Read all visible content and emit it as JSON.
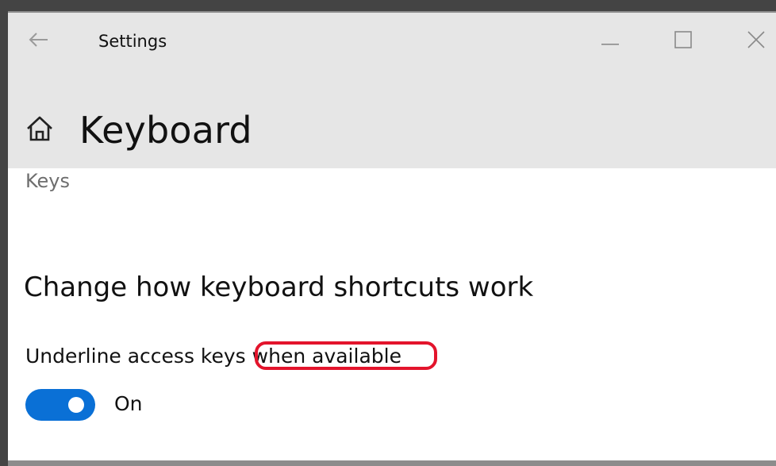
{
  "window": {
    "app_title": "Settings",
    "icons": {
      "back": "back-arrow-icon",
      "minimize": "minimize-icon",
      "maximize": "maximize-icon",
      "close": "close-icon",
      "home": "home-icon"
    }
  },
  "page": {
    "title": "Keyboard",
    "breadcrumb_partial": "Keys"
  },
  "section": {
    "title": "Change how keyboard shortcuts work",
    "setting": {
      "label": "Underline access keys when available",
      "toggle_state": "On",
      "toggle_on": true
    }
  },
  "colors": {
    "toggle_on": "#0a70d6",
    "highlight_annotation": "#e3142c",
    "header_bg": "#e6e6e6"
  }
}
